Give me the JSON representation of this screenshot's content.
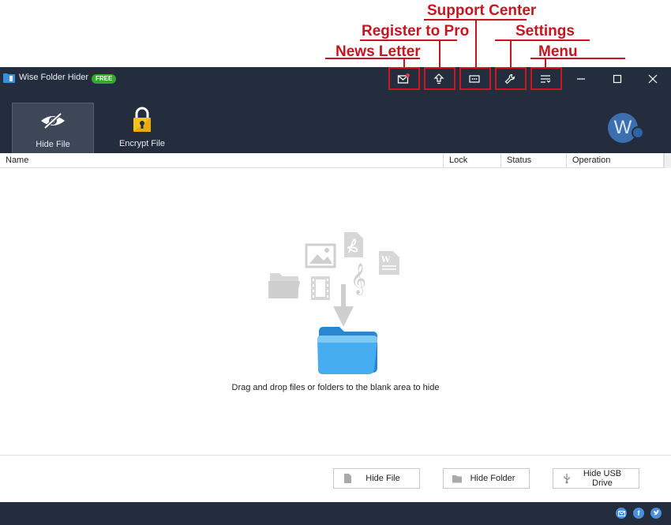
{
  "annotations": {
    "support_center": "Support Center",
    "register_to_pro": "Register to Pro",
    "settings": "Settings",
    "news_letter": "News Letter",
    "menu": "Menu"
  },
  "window": {
    "title": "Wise Folder Hider",
    "badge": "FREE",
    "buttons": [
      "mail-icon",
      "upgrade-icon",
      "support-icon",
      "wrench-icon",
      "menu-icon"
    ],
    "controls": [
      "minimize",
      "maximize",
      "close"
    ]
  },
  "toolbar": {
    "hide_file": "Hide File",
    "encrypt_file": "Encrypt File",
    "avatar_letter": "W"
  },
  "table": {
    "columns": [
      "Name",
      "Lock",
      "Status",
      "Operation"
    ]
  },
  "drop_area": {
    "hint": "Drag and drop files or folders to the blank area to hide"
  },
  "actions": {
    "hide_file": "Hide File",
    "hide_folder": "Hide Folder",
    "hide_usb": "Hide USB Drive"
  },
  "social": [
    "email-icon",
    "facebook-icon",
    "twitter-icon"
  ],
  "colors": {
    "titlebar": "#232d3d",
    "annotation": "#c8141e",
    "badge": "#3aa62f",
    "folder": "#3a9fe4"
  }
}
